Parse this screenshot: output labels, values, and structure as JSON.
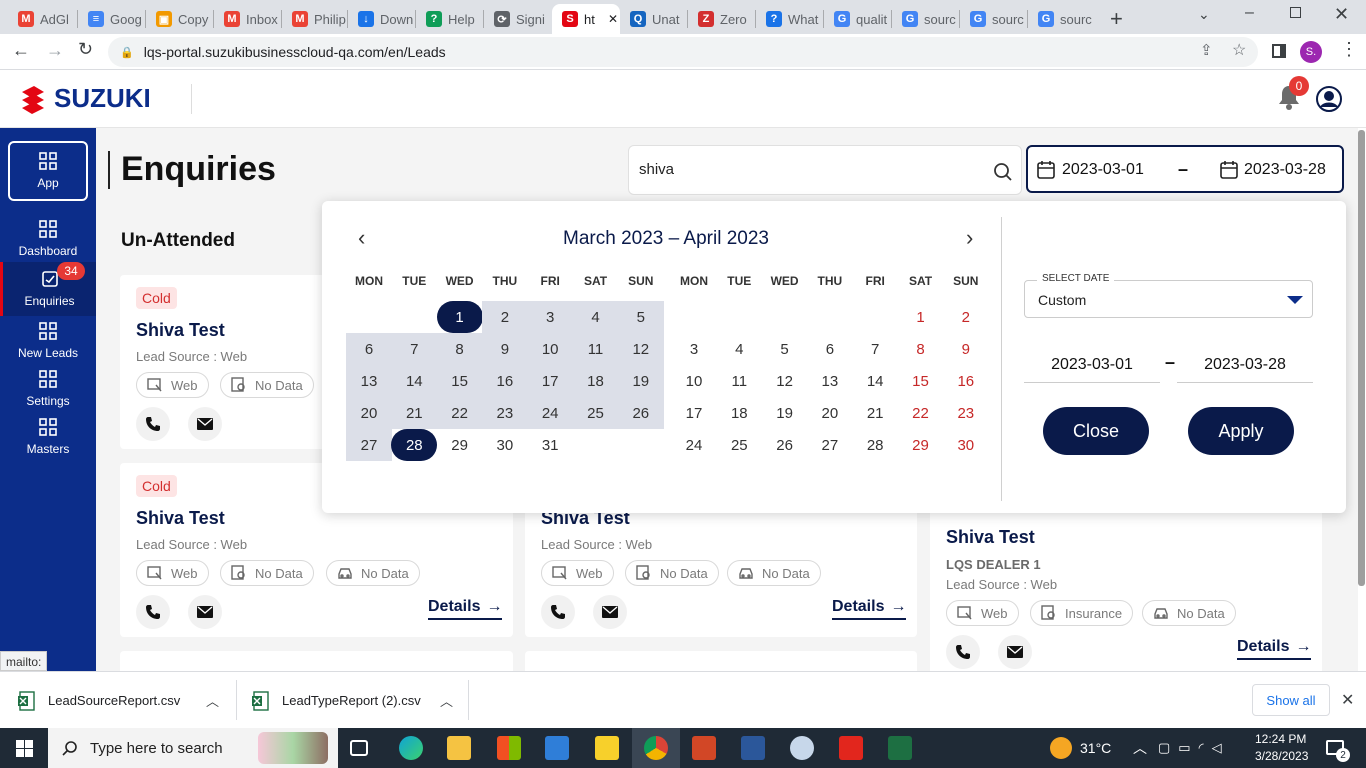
{
  "browser": {
    "tabs": [
      {
        "label": "AdGl",
        "icon": "gmail-icon",
        "color": "#ea4335"
      },
      {
        "label": "Goog",
        "icon": "google-docs-icon",
        "color": "#4285f4"
      },
      {
        "label": "Copy",
        "icon": "copy-icon",
        "color": "#f29900"
      },
      {
        "label": "Inbox",
        "icon": "gmail-icon",
        "color": "#ea4335"
      },
      {
        "label": "Philip",
        "icon": "gmail-icon",
        "color": "#ea4335"
      },
      {
        "label": "Down",
        "icon": "download-icon",
        "color": "#1a73e8"
      },
      {
        "label": "Help",
        "icon": "help-icon",
        "color": "#0f9d58"
      },
      {
        "label": "Signi",
        "icon": "signin-icon",
        "color": "#5f6368"
      },
      {
        "label": "ht",
        "icon": "suzuki-icon",
        "color": "#e30613",
        "active": true
      },
      {
        "label": "Unat",
        "icon": "search-q-icon",
        "color": "#1565c0"
      },
      {
        "label": "Zero",
        "icon": "zero-icon",
        "color": "#d32f2f"
      },
      {
        "label": "What",
        "icon": "question-icon",
        "color": "#1a73e8"
      },
      {
        "label": "qualit",
        "icon": "google-icon",
        "color": "#4285f4"
      },
      {
        "label": "sourc",
        "icon": "google-icon",
        "color": "#4285f4"
      },
      {
        "label": "sourc",
        "icon": "google-icon",
        "color": "#4285f4"
      },
      {
        "label": "sourc",
        "icon": "google-icon",
        "color": "#4285f4"
      }
    ],
    "url": "lqs-portal.suzukibusinesscloud-qa.com/en/Leads",
    "profile_initial": "S."
  },
  "app": {
    "brand": "SUZUKI",
    "brand_color": "#0c2d8a",
    "notification_count": "0",
    "page_title": "Enquiries",
    "search_value": "shiva",
    "date_from": "2023-03-01",
    "date_to": "2023-03-28",
    "section_title": "Un-Attended",
    "sidebar": [
      {
        "label": "App",
        "icon": "grid-icon"
      },
      {
        "label": "Dashboard",
        "icon": "grid-icon"
      },
      {
        "label": "Enquiries",
        "icon": "enquiries-icon",
        "badge": "34"
      },
      {
        "label": "New Leads",
        "icon": "grid-icon"
      },
      {
        "label": "Settings",
        "icon": "grid-icon"
      },
      {
        "label": "Masters",
        "icon": "grid-icon"
      }
    ],
    "cards": [
      {
        "badge": "Cold",
        "title": "Shiva Test",
        "source": "Lead Source : Web",
        "chips": [
          "Web",
          "No Data"
        ]
      },
      {
        "badge": "Cold",
        "title": "Shiva Test",
        "source": "Lead Source : Web",
        "chips": [
          "Web",
          "No Data",
          "No Data"
        ],
        "details": "Details"
      },
      {
        "title": "Shiva Test",
        "source": "Lead Source : Web",
        "chips": [
          "Web",
          "No Data",
          "No Data"
        ],
        "details": "Details"
      },
      {
        "title": "Shiva Test",
        "dealer": "LQS DEALER 1",
        "source": "Lead Source : Web",
        "chips": [
          "Web",
          "Insurance",
          "No Data"
        ],
        "details": "Details"
      }
    ],
    "status_text": "mailto:"
  },
  "calendar": {
    "left_title": "March 2023 – April 2023",
    "prev": "‹",
    "next": "›",
    "weekdays": [
      "MON",
      "TUE",
      "WED",
      "THU",
      "FRI",
      "SAT",
      "SUN"
    ],
    "march_days": [
      "1",
      "2",
      "3",
      "4",
      "5",
      "6",
      "7",
      "8",
      "9",
      "10",
      "11",
      "12",
      "13",
      "14",
      "15",
      "16",
      "17",
      "18",
      "19",
      "20",
      "21",
      "22",
      "23",
      "24",
      "25",
      "26",
      "27",
      "28",
      "29",
      "30",
      "31"
    ],
    "april_days": [
      "1",
      "2",
      "3",
      "4",
      "5",
      "6",
      "7",
      "8",
      "9",
      "10",
      "11",
      "12",
      "13",
      "14",
      "15",
      "16",
      "17",
      "18",
      "19",
      "20",
      "21",
      "22",
      "23",
      "24",
      "25",
      "26",
      "27",
      "28",
      "29",
      "30"
    ],
    "select_date_label": "SELECT DATE",
    "select_date_value": "Custom",
    "from": "2023-03-01",
    "dash": "–",
    "to": "2023-03-28",
    "close_label": "Close",
    "apply_label": "Apply"
  },
  "downloads": {
    "files": [
      "LeadSourceReport.csv",
      "LeadTypeReport (2).csv"
    ],
    "show_all": "Show all"
  },
  "taskbar": {
    "search_placeholder": "Type here to search",
    "weather": "31°C",
    "time": "12:24 PM",
    "date": "3/28/2023",
    "notif_count": "2"
  }
}
